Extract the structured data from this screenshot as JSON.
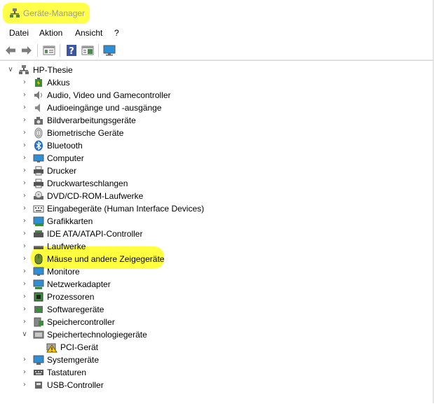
{
  "window": {
    "title": "Geräte-Manager"
  },
  "menu": {
    "items": [
      "Datei",
      "Aktion",
      "Ansicht",
      "?"
    ]
  },
  "toolbar": {
    "buttons": [
      "back-arrow-icon",
      "forward-arrow-icon",
      "properties-icon",
      "help-icon",
      "console-tree-icon",
      "monitor-scan-icon"
    ]
  },
  "tree": {
    "root": "HP-Thesie",
    "categories": [
      "Akkus",
      "Audio, Video und Gamecontroller",
      "Audioeingänge und -ausgänge",
      "Bildverarbeitungsgeräte",
      "Biometrische Geräte",
      "Bluetooth",
      "Computer",
      "Drucker",
      "Druckwarteschlangen",
      "DVD/CD-ROM-Laufwerke",
      "Eingabegeräte (Human Interface Devices)",
      "Grafikkarten",
      "IDE ATA/ATAPI-Controller",
      "Laufwerke",
      "Mäuse und andere Zeigegeräte",
      "Monitore",
      "Netzwerkadapter",
      "Prozessoren",
      "Softwaregeräte",
      "Speichercontroller",
      "Speichertechnologiegeräte",
      "PCI-Gerät",
      "Systemgeräte",
      "Tastaturen",
      "USB-Controller"
    ]
  },
  "highlight": "#ffff40"
}
